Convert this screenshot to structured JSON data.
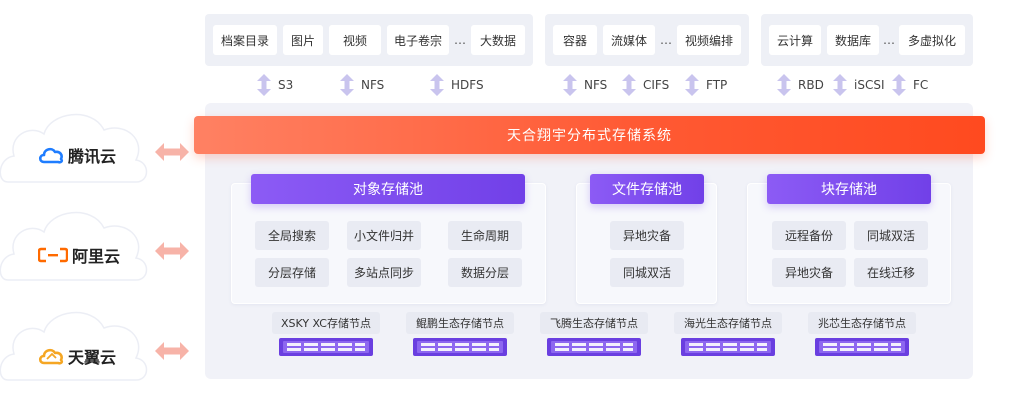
{
  "app_groups": [
    {
      "chips": [
        "档案目录",
        "图片",
        "视频",
        "电子卷宗",
        "大数据"
      ],
      "dots": "…"
    },
    {
      "chips": [
        "容器",
        "流媒体",
        "视频编排"
      ],
      "dots": "…"
    },
    {
      "chips": [
        "云计算",
        "数据库",
        "多虚拟化"
      ],
      "dots": "…"
    }
  ],
  "protocols": [
    "S3",
    "NFS",
    "HDFS",
    "NFS",
    "CIFS",
    "FTP",
    "RBD",
    "iSCSI",
    "FC"
  ],
  "banner_title": "天合翔宇分布式存储系统",
  "pools": [
    {
      "title": "对象存储池",
      "features": [
        "全局搜索",
        "小文件归并",
        "生命周期",
        "分层存储",
        "多站点同步",
        "数据分层"
      ]
    },
    {
      "title": "文件存储池",
      "features": [
        "异地灾备",
        "同城双活"
      ]
    },
    {
      "title": "块存储池",
      "features": [
        "远程备份",
        "同城双活",
        "异地灾备",
        "在线迁移"
      ]
    }
  ],
  "nodes": [
    "XSKY XC存储节点",
    "鲲鹏生态存储节点",
    "飞腾生态存储节点",
    "海光生态存储节点",
    "兆芯生态存储节点"
  ],
  "clouds": [
    "腾讯云",
    "阿里云",
    "天翼云"
  ],
  "colors": {
    "banner": "#ff5a34",
    "pool_title": "#7c4dee",
    "arrow": "#c9c4ee",
    "h_arrow": "#f7b3a8",
    "tencent": "#1f7dff",
    "aliyun": "#ff6a00",
    "tianyi": "#f5a623"
  }
}
